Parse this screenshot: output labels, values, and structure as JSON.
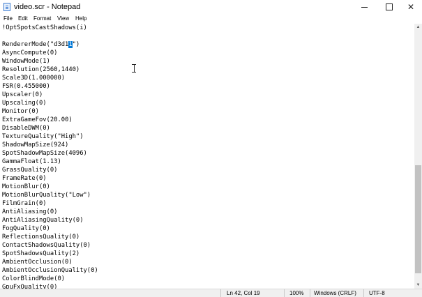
{
  "window": {
    "title": "video.scr - Notepad",
    "minimize_glyph": "",
    "maximize_glyph": "",
    "close_glyph": "✕"
  },
  "menu": [
    "File",
    "Edit",
    "Format",
    "View",
    "Help"
  ],
  "editor": {
    "lines": [
      "!OptSpotsCastShadows(i)",
      "",
      "RendererMode(\"d3d1",
      "AsyncCompute(0)",
      "WindowMode(1)",
      "Resolution(2560,1440)",
      "Scale3D(1.000000)",
      "FSR(0.455000)",
      "Upscaler(0)",
      "Upscaling(0)",
      "Monitor(0)",
      "ExtraGameFov(20.00)",
      "DisableDWM(0)",
      "TextureQuality(\"High\")",
      "ShadowMapSize(924)",
      "SpotShadowMapSize(4096)",
      "GammaFloat(1.13)",
      "GrassQuality(0)",
      "FrameRate(0)",
      "MotionBlur(0)",
      "MotionBlurQuality(\"Low\")",
      "FilmGrain(0)",
      "AntiAliasing(0)",
      "AntiAliasingQuality(0)",
      "FogQuality(0)",
      "ReflectionsQuality(0)",
      "ContactShadowsQuality(0)",
      "SpotShadowsQuality(2)",
      "AmbientOcclusion(0)",
      "AmbientOcclusionQuality(0)",
      "ColorBlindMode(0)",
      "GpuFxQuality(0)"
    ],
    "selection_text": "1",
    "selection_suffix": "\")"
  },
  "status": {
    "position": "Ln 42, Col 19",
    "zoom": "100%",
    "line_ending": "Windows (CRLF)",
    "encoding": "UTF-8"
  },
  "colors": {
    "selection": "#0078d7"
  }
}
